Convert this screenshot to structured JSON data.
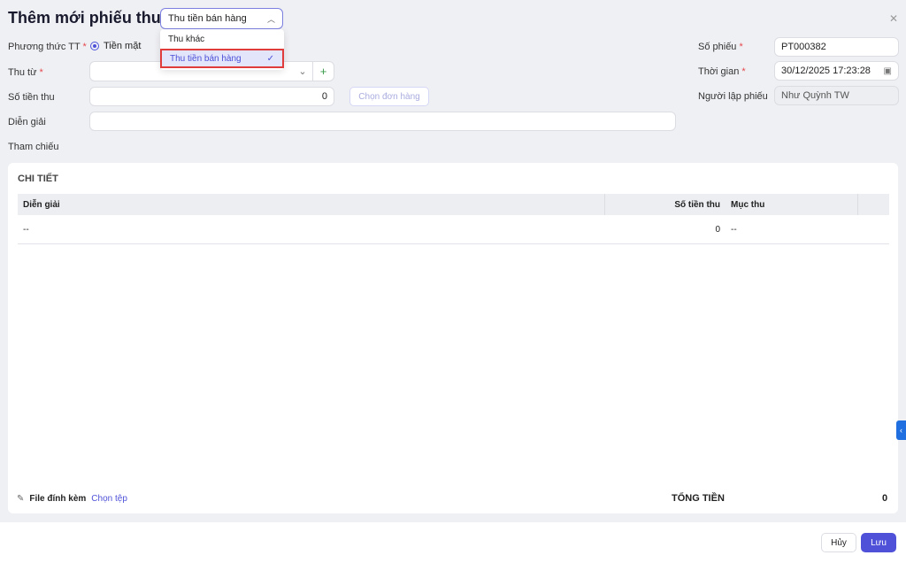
{
  "title": "Thêm mới phiếu thu",
  "type_select": {
    "value": "Thu tiền bán hàng",
    "options": [
      "Thu khác",
      "Thu tiền bán hàng"
    ]
  },
  "form": {
    "payment_method_label": "Phương thức TT",
    "payment_method_value": "Tiền mặt",
    "from_label": "Thu từ",
    "from_value": "",
    "amount_label": "Số tiền thu",
    "amount_value": "0",
    "choose_order": "Chọn đơn hàng",
    "desc_label": "Diễn giải",
    "desc_value": "",
    "ref_label": "Tham chiếu",
    "receipt_no_label": "Số phiếu",
    "receipt_no_value": "PT000382",
    "time_label": "Thời gian",
    "time_value": "30/12/2025 17:23:28",
    "creator_label": "Người lập phiếu",
    "creator_value": "Như Quỳnh TW"
  },
  "detail": {
    "title": "CHI TIẾT",
    "columns": [
      "Diễn giải",
      "Số tiền thu",
      "Mục thu"
    ],
    "rows": [
      {
        "desc": "--",
        "amount": "0",
        "category": "--"
      }
    ]
  },
  "attach_label": "File đính kèm",
  "choose_file": "Chọn tệp",
  "total_label": "TỔNG TIỀN",
  "total_value": "0",
  "cancel": "Hủy",
  "save": "Lưu",
  "colors": {
    "accent": "#4f52d9"
  }
}
